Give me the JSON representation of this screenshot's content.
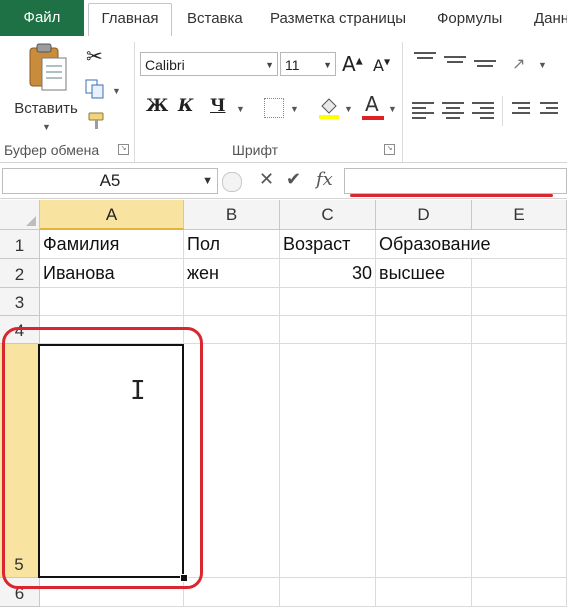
{
  "tabs": [
    {
      "label": "Файл",
      "state": "file"
    },
    {
      "label": "Главная",
      "state": "active"
    },
    {
      "label": "Вставка",
      "state": "normal"
    },
    {
      "label": "Разметка страницы",
      "state": "normal"
    },
    {
      "label": "Формулы",
      "state": "normal"
    },
    {
      "label": "Данн",
      "state": "normal"
    }
  ],
  "ribbon": {
    "clipboard": {
      "paste_label": "Вставить",
      "group_label": "Буфер обмена"
    },
    "font": {
      "group_label": "Шрифт",
      "font_name": "Calibri",
      "font_size": "11",
      "bold": "Ж",
      "italic": "К",
      "underline": "Ч",
      "font_color_letter": "A",
      "font_color": "#e02020"
    }
  },
  "formula_bar": {
    "name_box": "A5",
    "fx_label": "fx",
    "formula": ""
  },
  "sheet": {
    "columns": [
      "A",
      "B",
      "C",
      "D",
      "E"
    ],
    "rows": [
      "1",
      "2",
      "3",
      "4",
      "5",
      "6"
    ],
    "selected_cell": "A5",
    "cells": {
      "a1": "Фамилия",
      "b1": "Пол",
      "c1": "Возраст",
      "d1": "Образование",
      "a2": "Иванова",
      "b2": "жен",
      "c2": "30",
      "d2": "высшее"
    }
  },
  "colors": {
    "file_tab": "#1e7145",
    "selection_header": "#f9e3a0",
    "annotation_red": "#d9262f"
  }
}
